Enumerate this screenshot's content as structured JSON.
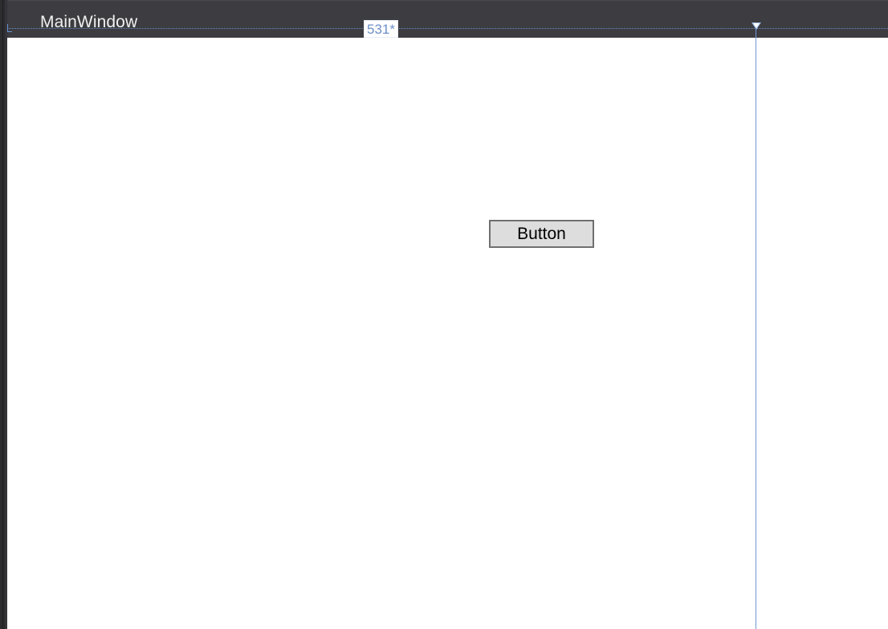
{
  "window": {
    "title": "MainWindow"
  },
  "designer": {
    "column_width_label": "531*"
  },
  "controls": {
    "button_label": "Button"
  },
  "colors": {
    "titlebar": "#3c3c41",
    "guide": "#6e96d6",
    "client_background": "#ffffff",
    "button_background": "#dddddd",
    "button_border": "#707070"
  }
}
